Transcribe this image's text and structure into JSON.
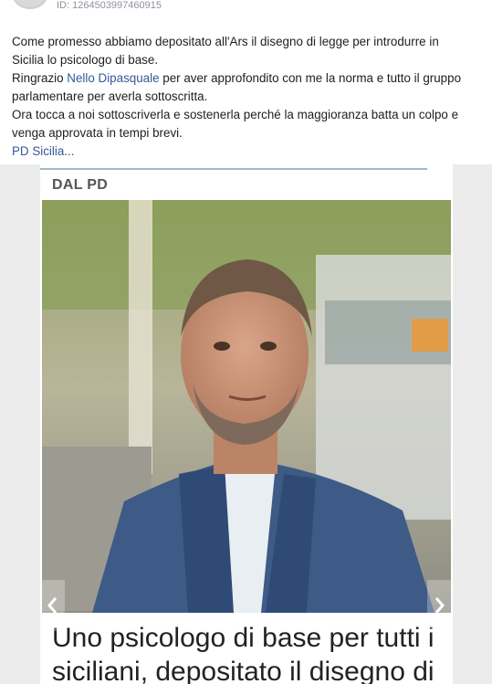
{
  "post": {
    "id_text": "ID: 1264503997460915",
    "lines": [
      "Come promesso abbiamo depositato all'Ars il disegno di legge per introdurre in",
      "Sicilia lo psicologo di base.",
      "parlamentare per averla sottoscritta.",
      "Ora tocca a noi sottoscriverla e sostenerla perché la maggioranza batta un colpo e",
      "venga approvata in tempi brevi."
    ],
    "thanks_prefix": "Ringrazio ",
    "mention": "Nello Dipasquale",
    "thanks_suffix": " per aver approfondito con me la norma e tutto il gruppo",
    "page_link": "PD Sicilia",
    "ellipsis": "..."
  },
  "article": {
    "section": "DAL PD",
    "headline": "Uno psicologo di base per tutti i siciliani, depositato il disegno di"
  },
  "icons": {
    "prev": "chevron-left-icon",
    "next": "chevron-right-icon"
  },
  "colors": {
    "link": "#385898",
    "text": "#1c1e21",
    "muted": "#8d949e"
  }
}
